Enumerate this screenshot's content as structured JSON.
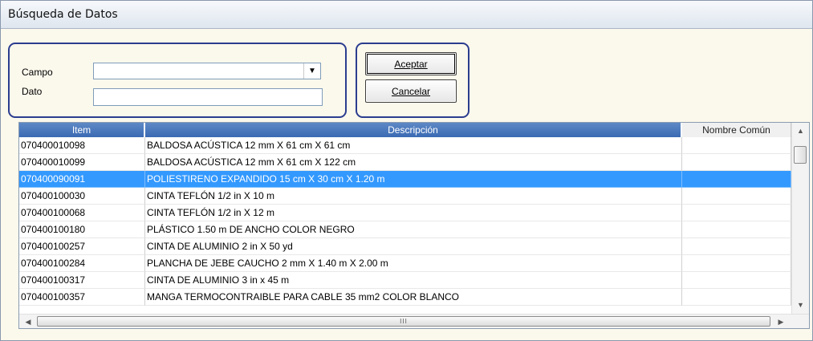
{
  "window": {
    "title": "Búsqueda de Datos"
  },
  "search": {
    "campo_label": "Campo",
    "campo_value": "",
    "dato_label": "Dato",
    "dato_value": ""
  },
  "buttons": {
    "ok_label": "Aceptar",
    "cancel_label": "Cancelar"
  },
  "grid": {
    "columns": [
      "Item",
      "Descripción",
      "Nombre Común"
    ],
    "rows": [
      {
        "item": "070400010098",
        "descripcion": "BALDOSA ACÚSTICA 12 mm X 61 cm X 61 cm",
        "nombre": "",
        "selected": false
      },
      {
        "item": "070400010099",
        "descripcion": "BALDOSA ACÚSTICA 12 mm X 61 cm X 122 cm",
        "nombre": "",
        "selected": false
      },
      {
        "item": "070400090091",
        "descripcion": "POLIESTIRENO EXPANDIDO 15 cm X 30 cm X 1.20 m",
        "nombre": "",
        "selected": true
      },
      {
        "item": "070400100030",
        "descripcion": "CINTA TEFLÓN 1/2 in X 10 m",
        "nombre": "",
        "selected": false
      },
      {
        "item": "070400100068",
        "descripcion": "CINTA TEFLÓN 1/2 in X 12 m",
        "nombre": "",
        "selected": false
      },
      {
        "item": "070400100180",
        "descripcion": "PLÁSTICO 1.50 m DE ANCHO COLOR NEGRO",
        "nombre": "",
        "selected": false
      },
      {
        "item": "070400100257",
        "descripcion": "CINTA DE ALUMINIO 2 in X 50 yd",
        "nombre": "",
        "selected": false
      },
      {
        "item": "070400100284",
        "descripcion": "PLANCHA DE JEBE CAUCHO 2 mm X 1.40 m X 2.00 m",
        "nombre": "",
        "selected": false
      },
      {
        "item": "070400100317",
        "descripcion": "CINTA DE ALUMINIO 3 in x 45 m",
        "nombre": "",
        "selected": false
      },
      {
        "item": "070400100357",
        "descripcion": "MANGA TERMOCONTRAIBLE PARA CABLE 35 mm2 COLOR BLANCO",
        "nombre": "",
        "selected": false
      }
    ]
  },
  "scrollbar": {
    "h_grip": "III"
  },
  "colors": {
    "header": "#3a6ab3",
    "selection": "#3399ff",
    "group_border": "#2b3d8f"
  }
}
